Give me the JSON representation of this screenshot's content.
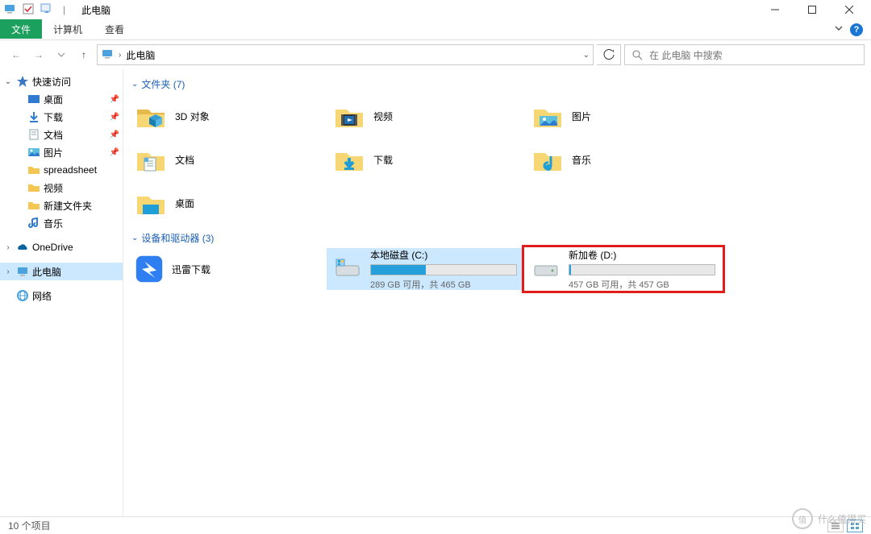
{
  "titlebar": {
    "title": "此电脑"
  },
  "ribbon": {
    "file": "文件",
    "tabs": [
      "计算机",
      "查看"
    ]
  },
  "addr": {
    "crumb": "此电脑",
    "search_placeholder": "在 此电脑 中搜索"
  },
  "sidebar": {
    "quick": {
      "label": "快速访问"
    },
    "quick_items": [
      {
        "label": "桌面",
        "icon": "desktop",
        "pinned": true
      },
      {
        "label": "下载",
        "icon": "downloads",
        "pinned": true
      },
      {
        "label": "文档",
        "icon": "documents",
        "pinned": true
      },
      {
        "label": "图片",
        "icon": "pictures",
        "pinned": true
      },
      {
        "label": "spreadsheet",
        "icon": "folder",
        "pinned": false
      },
      {
        "label": "视频",
        "icon": "videos",
        "pinned": false
      },
      {
        "label": "新建文件夹",
        "icon": "folder",
        "pinned": false
      },
      {
        "label": "音乐",
        "icon": "music",
        "pinned": false
      }
    ],
    "onedrive": "OneDrive",
    "thispc": "此电脑",
    "network": "网络"
  },
  "sections": {
    "folders": {
      "header": "文件夹 (7)"
    },
    "devices": {
      "header": "设备和驱动器 (3)"
    }
  },
  "folders": [
    {
      "label": "3D 对象",
      "icon": "3d"
    },
    {
      "label": "视频",
      "icon": "videos"
    },
    {
      "label": "图片",
      "icon": "pictures"
    },
    {
      "label": "文档",
      "icon": "documents"
    },
    {
      "label": "下载",
      "icon": "downloads"
    },
    {
      "label": "音乐",
      "icon": "music"
    },
    {
      "label": "桌面",
      "icon": "desktop"
    }
  ],
  "drives": [
    {
      "label": "迅雷下载",
      "type": "app",
      "icon": "xunlei"
    },
    {
      "label": "本地磁盘 (C:)",
      "type": "disk",
      "status": "289 GB 可用，共 465 GB",
      "fill_pct": 38,
      "selected": true
    },
    {
      "label": "新加卷 (D:)",
      "type": "disk",
      "status": "457 GB 可用，共 457 GB",
      "fill_pct": 1,
      "highlighted": true
    }
  ],
  "status": {
    "text": "10 个项目"
  },
  "watermark": {
    "text": "什么值得买",
    "badge": "值"
  }
}
